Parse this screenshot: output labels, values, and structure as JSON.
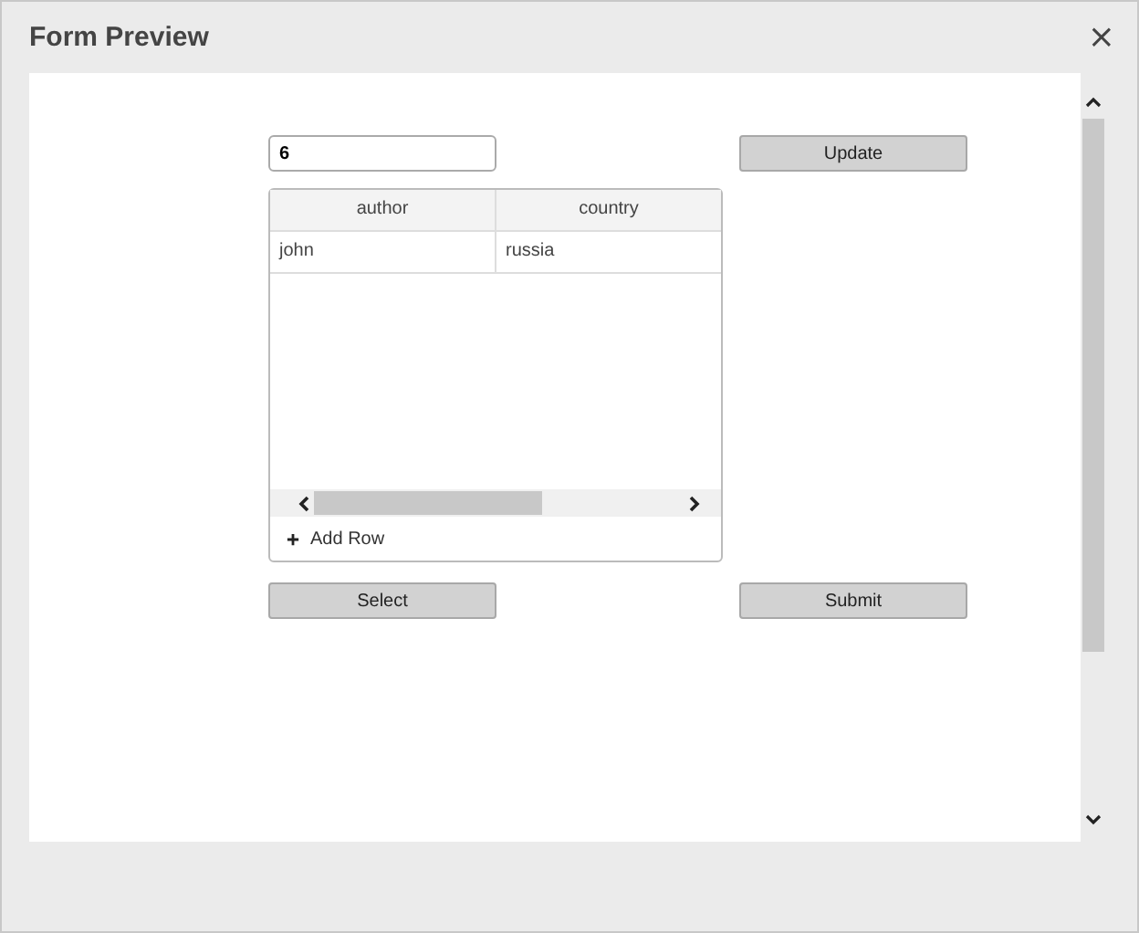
{
  "window": {
    "title": "Form Preview",
    "close": "×"
  },
  "field": {
    "value": "6"
  },
  "buttons": {
    "update": "Update",
    "select": "Select",
    "submit": "Submit"
  },
  "table": {
    "columns": [
      "author",
      "country"
    ],
    "rows": [
      [
        "john",
        "russia"
      ]
    ],
    "add_row": "Add Row"
  }
}
